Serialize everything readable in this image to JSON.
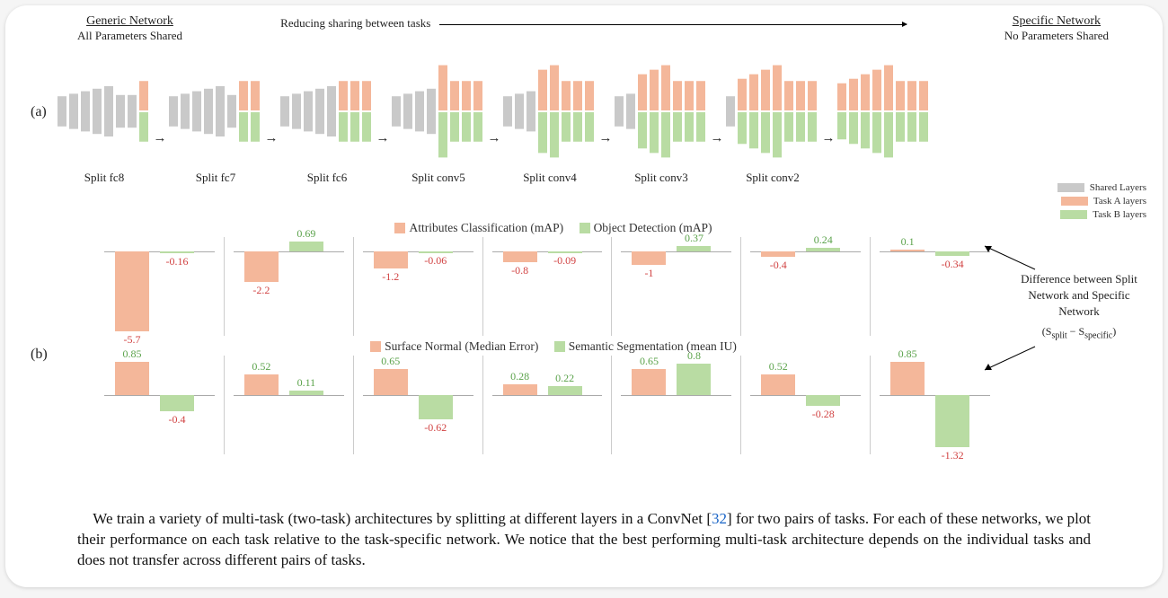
{
  "header": {
    "generic_title": "Generic Network",
    "generic_sub": "All Parameters Shared",
    "center_text": "Reducing sharing between tasks",
    "specific_title": "Specific Network",
    "specific_sub": "No Parameters Shared"
  },
  "row_labels": {
    "a": "(a)",
    "b": "(b)"
  },
  "legend": {
    "shared": "Shared Layers",
    "taskA": "Task A layers",
    "taskB": "Task B layers"
  },
  "colors": {
    "shared": "#c9c9c9",
    "taskA": "#f4b79a",
    "taskB": "#b9dca3",
    "neg": "#d14242",
    "pos": "#5aa24a"
  },
  "networks": [
    {
      "label": "Split fc8",
      "shared": 7,
      "split": 1
    },
    {
      "label": "Split fc7",
      "shared": 6,
      "split": 2
    },
    {
      "label": "Split fc6",
      "shared": 5,
      "split": 3
    },
    {
      "label": "Split conv5",
      "shared": 4,
      "split": 4
    },
    {
      "label": "Split conv4",
      "shared": 3,
      "split": 5
    },
    {
      "label": "Split conv3",
      "shared": 2,
      "split": 6
    },
    {
      "label": "Split conv2",
      "shared": 1,
      "split": 7
    },
    {
      "label": "",
      "shared": 0,
      "split": 8
    }
  ],
  "chart_data": [
    {
      "type": "bar",
      "title_segments": [
        "Attributes Classification (mAP)",
        "Object Detection (mAP)"
      ],
      "categories": [
        "Split fc8",
        "Split fc7",
        "Split fc6",
        "Split conv5",
        "Split conv4",
        "Split conv3",
        "Split conv2"
      ],
      "series": [
        {
          "name": "Attributes Classification (mAP)",
          "values": [
            -5.7,
            -2.2,
            -1.2,
            -0.8,
            -1.0,
            -0.4,
            0.1
          ]
        },
        {
          "name": "Object Detection (mAP)",
          "values": [
            -0.16,
            0.69,
            -0.06,
            -0.09,
            0.37,
            0.24,
            -0.34
          ]
        }
      ],
      "ylim": [
        -6,
        1
      ]
    },
    {
      "type": "bar",
      "title_segments": [
        "Surface Normal (Median Error)",
        "Semantic Segmentation (mean IU)"
      ],
      "categories": [
        "Split fc8",
        "Split fc7",
        "Split fc6",
        "Split conv5",
        "Split conv4",
        "Split conv3",
        "Split conv2"
      ],
      "series": [
        {
          "name": "Surface Normal (Median Error)",
          "values": [
            0.85,
            0.52,
            0.65,
            0.28,
            0.65,
            0.52,
            0.85
          ]
        },
        {
          "name": "Semantic Segmentation (mean IU)",
          "values": [
            -0.4,
            0.11,
            -0.62,
            0.22,
            0.8,
            -0.28,
            -1.32
          ]
        }
      ],
      "ylim": [
        -1.5,
        1
      ]
    }
  ],
  "side_caption": {
    "lines": "Difference between Split Network and Specific Network",
    "formula": "(S_split − S_specific)"
  },
  "caption": {
    "text_pre": "We train a variety of multi-task (two-task) architectures by splitting at different layers in a ConvNet [",
    "cite": "32",
    "text_post": "] for two pairs of tasks. For each of these networks, we plot their performance on each task relative to the task-specific network. We notice that the best performing multi-task architecture depends on the individual tasks and does not transfer across different pairs of tasks."
  }
}
